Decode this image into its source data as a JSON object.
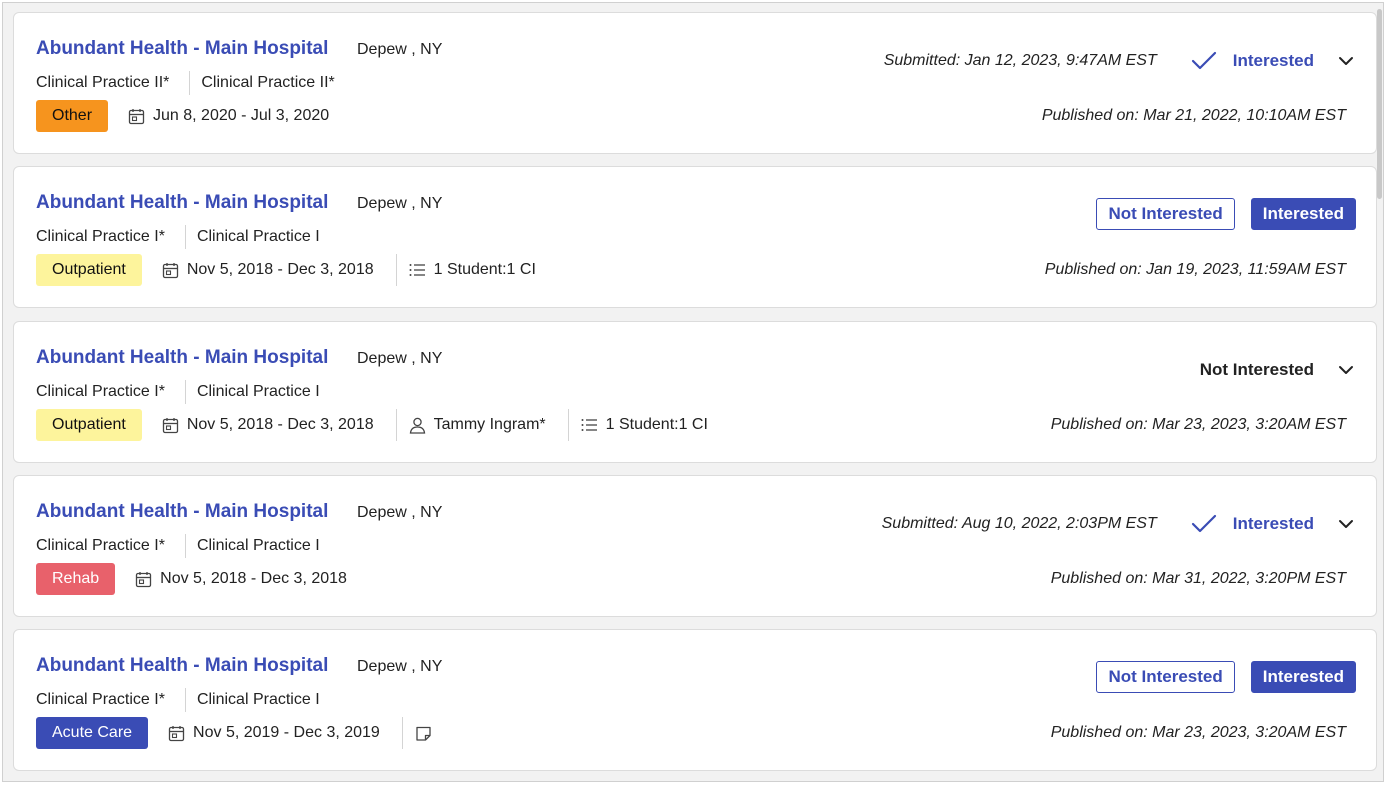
{
  "placements": [
    {
      "title": "Abundant Health - Main Hospital",
      "location": "Depew , NY",
      "course_primary": "Clinical Practice II*",
      "course_secondary": "Clinical Practice II*",
      "setting": "Other",
      "dates": "Jun 8, 2020 - Jul 3, 2020",
      "submitted": "Submitted: Jan 12, 2023, 9:47AM EST",
      "status": "Interested",
      "published": "Published on: Mar 21, 2022, 10:10AM EST"
    },
    {
      "title": "Abundant Health - Main Hospital",
      "location": "Depew , NY",
      "course_primary": "Clinical Practice I*",
      "course_secondary": "Clinical Practice I",
      "setting": "Outpatient",
      "dates": "Nov 5, 2018 - Dec 3, 2018",
      "ratio": "1 Student:1 CI",
      "btn_not_interested": "Not Interested",
      "btn_interested": "Interested",
      "published": "Published on: Jan 19, 2023, 11:59AM EST"
    },
    {
      "title": "Abundant Health - Main Hospital",
      "location": "Depew , NY",
      "course_primary": "Clinical Practice I*",
      "course_secondary": "Clinical Practice I",
      "setting": "Outpatient",
      "dates": "Nov 5, 2018 - Dec 3, 2018",
      "instructor": "Tammy Ingram*",
      "ratio": "1 Student:1 CI",
      "status": "Not Interested",
      "published": "Published on: Mar 23, 2023, 3:20AM EST"
    },
    {
      "title": "Abundant Health - Main Hospital",
      "location": "Depew , NY",
      "course_primary": "Clinical Practice I*",
      "course_secondary": "Clinical Practice I",
      "setting": "Rehab",
      "dates": "Nov 5, 2018 - Dec 3, 2018",
      "submitted": "Submitted: Aug 10, 2022, 2:03PM EST",
      "status": "Interested",
      "published": "Published on: Mar 31, 2022, 3:20PM EST"
    },
    {
      "title": "Abundant Health - Main Hospital",
      "location": "Depew , NY",
      "course_primary": "Clinical Practice I*",
      "course_secondary": "Clinical Practice I",
      "setting": "Acute Care",
      "dates": "Nov 5, 2019 - Dec 3, 2019",
      "btn_not_interested": "Not Interested",
      "btn_interested": "Interested",
      "published": "Published on: Mar 23, 2023, 3:20AM EST"
    }
  ],
  "colors": {
    "accent": "#3a4cb5",
    "tag_other": "#f6941e",
    "tag_outpatient": "#fdf49c",
    "tag_rehab": "#e8616b",
    "tag_acute": "#3a4cb5"
  },
  "icons": [
    "calendar-icon",
    "list-icon",
    "person-icon",
    "note-icon",
    "check-icon",
    "chevron-down-icon"
  ]
}
